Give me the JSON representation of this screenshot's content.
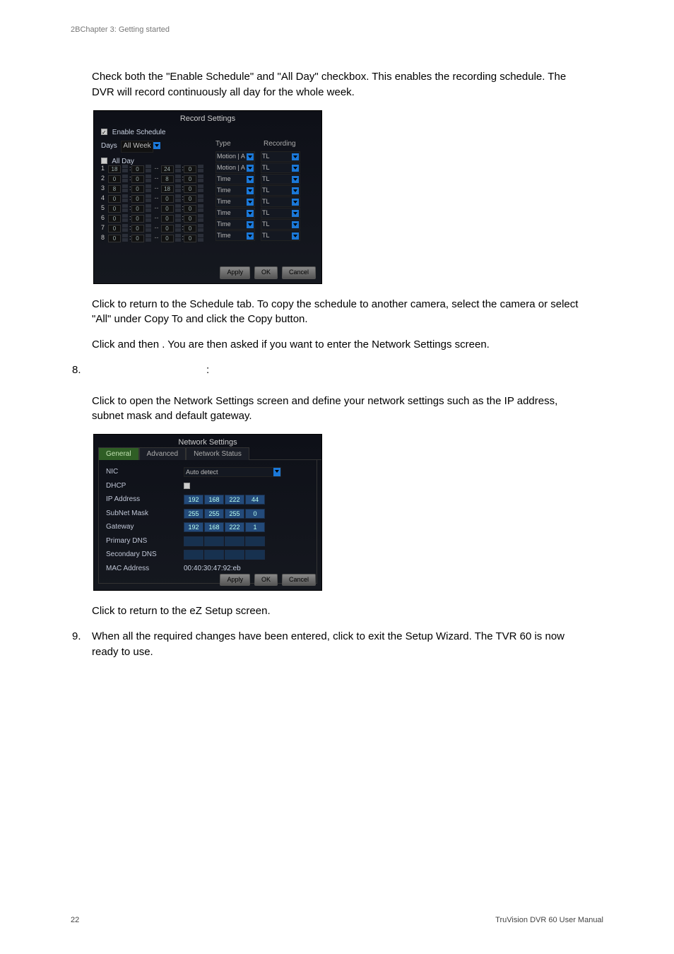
{
  "header": "2BChapter 3: Getting started",
  "footer": {
    "page": "22",
    "manual": "TruVision DVR 60 User Manual"
  },
  "body": {
    "p1": "Check both the \"Enable Schedule\" and \"All Day\" checkbox. This enables the recording schedule. The DVR will record continuously all day for the whole week.",
    "p2a": "Click ",
    "p2b": " to return to the Schedule tab. To copy the schedule to another camera, select the camera or select \"All\" under Copy To and click the Copy button.",
    "p3a": "Click ",
    "p3b": " and then ",
    "p3c": ". You are then asked if you want to enter the Network Settings screen.",
    "step8num": "8.",
    "step8label": ":",
    "p4a": "Click ",
    "p4b": " to open the Network Settings screen and define your network settings such as the IP address, subnet mask and default gateway.",
    "p5a": "Click ",
    "p5b": " to return to the eZ Setup screen.",
    "step9num": "9.",
    "step9a": "When all the required changes have been entered, click ",
    "step9b": " to exit the Setup Wizard. The TVR 60 is now ready to use."
  },
  "shot1": {
    "title": "Record Settings",
    "enable": "Enable Schedule",
    "daysLbl": "Days",
    "daysVal": "All Week",
    "allday": "All Day",
    "typeHdr": "Type",
    "recHdr": "Recording",
    "rows": [
      {
        "n": "1",
        "a": "18",
        "b": "0",
        "c": "24",
        "d": "0",
        "type": "Motion | A",
        "rec": "TL"
      },
      {
        "n": "2",
        "a": "0",
        "b": "0",
        "c": "8",
        "d": "0",
        "type": "Motion | A",
        "rec": "TL"
      },
      {
        "n": "3",
        "a": "8",
        "b": "0",
        "c": "18",
        "d": "0",
        "type": "Time",
        "rec": "TL"
      },
      {
        "n": "4",
        "a": "0",
        "b": "0",
        "c": "0",
        "d": "0",
        "type": "Time",
        "rec": "TL"
      },
      {
        "n": "5",
        "a": "0",
        "b": "0",
        "c": "0",
        "d": "0",
        "type": "Time",
        "rec": "TL"
      },
      {
        "n": "6",
        "a": "0",
        "b": "0",
        "c": "0",
        "d": "0",
        "type": "Time",
        "rec": "TL"
      },
      {
        "n": "7",
        "a": "0",
        "b": "0",
        "c": "0",
        "d": "0",
        "type": "Time",
        "rec": "TL"
      },
      {
        "n": "8",
        "a": "0",
        "b": "0",
        "c": "0",
        "d": "0",
        "type": "Time",
        "rec": "TL"
      }
    ],
    "btns": {
      "apply": "Apply",
      "ok": "OK",
      "cancel": "Cancel"
    }
  },
  "shot2": {
    "title": "Network Settings",
    "tabs": {
      "general": "General",
      "advanced": "Advanced",
      "status": "Network Status"
    },
    "rows": {
      "nic": {
        "lbl": "NIC",
        "val": "Auto detect"
      },
      "dhcp": {
        "lbl": "DHCP"
      },
      "ip": {
        "lbl": "IP Address",
        "o": [
          "192",
          "168",
          "222",
          "44"
        ]
      },
      "mask": {
        "lbl": "SubNet Mask",
        "o": [
          "255",
          "255",
          "255",
          "0"
        ]
      },
      "gw": {
        "lbl": "Gateway",
        "o": [
          "192",
          "168",
          "222",
          "1"
        ]
      },
      "pdns": {
        "lbl": "Primary DNS",
        "o": [
          "",
          "",
          "",
          ""
        ]
      },
      "sdns": {
        "lbl": "Secondary DNS",
        "o": [
          "",
          "",
          "",
          ""
        ]
      },
      "mac": {
        "lbl": "MAC Address",
        "val": "00:40:30:47:92:eb"
      }
    },
    "btns": {
      "apply": "Apply",
      "ok": "OK",
      "cancel": "Cancel"
    }
  }
}
